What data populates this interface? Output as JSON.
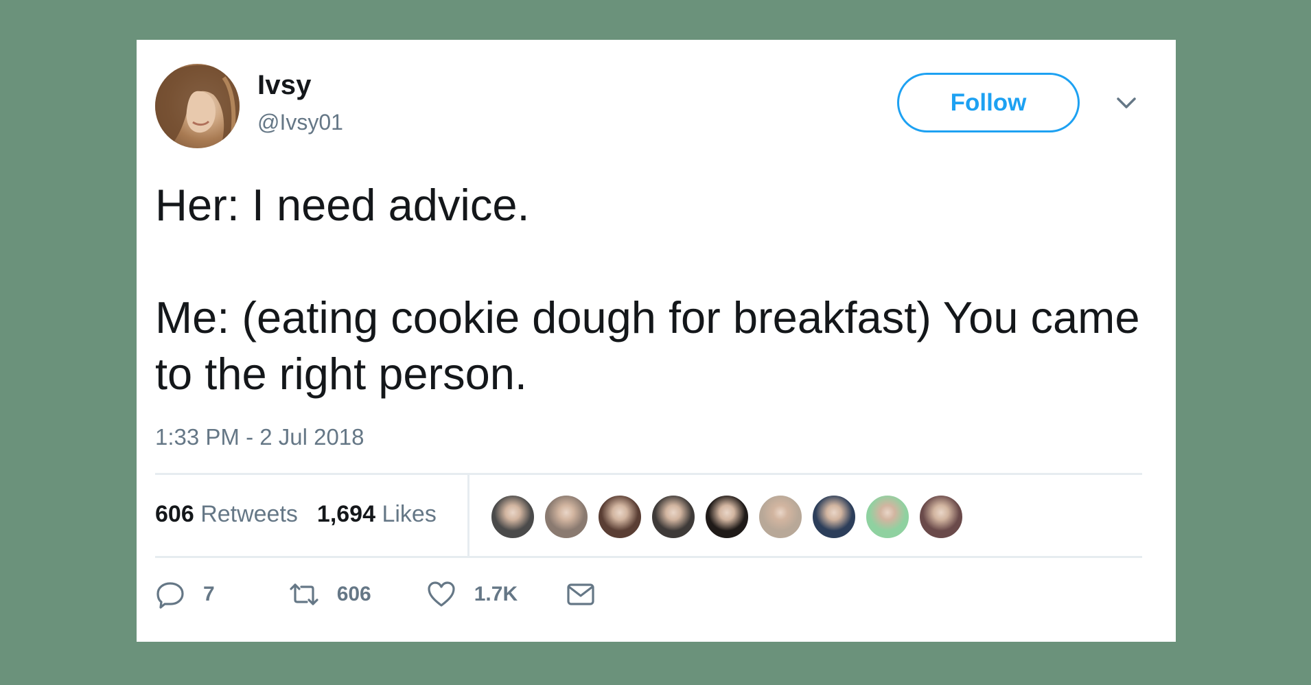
{
  "tweet": {
    "display_name": "Ivsy",
    "handle": "@Ivsy01",
    "follow_label": "Follow",
    "text_lines": [
      "Her: I need advice.",
      "Me: (eating cookie dough for breakfast) You came to the right person."
    ],
    "timestamp": "1:33 PM - 2 Jul 2018"
  },
  "stats": {
    "retweets_count": "606",
    "retweets_label": "Retweets",
    "likes_count": "1,694",
    "likes_label": "Likes"
  },
  "actions": {
    "reply_count": "7",
    "retweet_count": "606",
    "like_count": "1.7K"
  },
  "likers": [
    {
      "name": "liker-avatar-1",
      "color": "#4a4a4a"
    },
    {
      "name": "liker-avatar-2",
      "color": "#8a7a70"
    },
    {
      "name": "liker-avatar-3",
      "color": "#5a3e34"
    },
    {
      "name": "liker-avatar-4",
      "color": "#3e3a38"
    },
    {
      "name": "liker-avatar-5",
      "color": "#1f1a18"
    },
    {
      "name": "liker-avatar-6",
      "color": "#b8a898"
    },
    {
      "name": "liker-avatar-7",
      "color": "#2c3e5a"
    },
    {
      "name": "liker-avatar-8",
      "color": "#8fd1a0"
    },
    {
      "name": "liker-avatar-9",
      "color": "#6a4a4a"
    }
  ],
  "colors": {
    "background": "#6b927b",
    "accent": "#1da1f2",
    "text_primary": "#14171a",
    "text_secondary": "#657786"
  },
  "icons": [
    "chevron-down-icon",
    "reply-icon",
    "retweet-icon",
    "heart-icon",
    "envelope-icon"
  ]
}
